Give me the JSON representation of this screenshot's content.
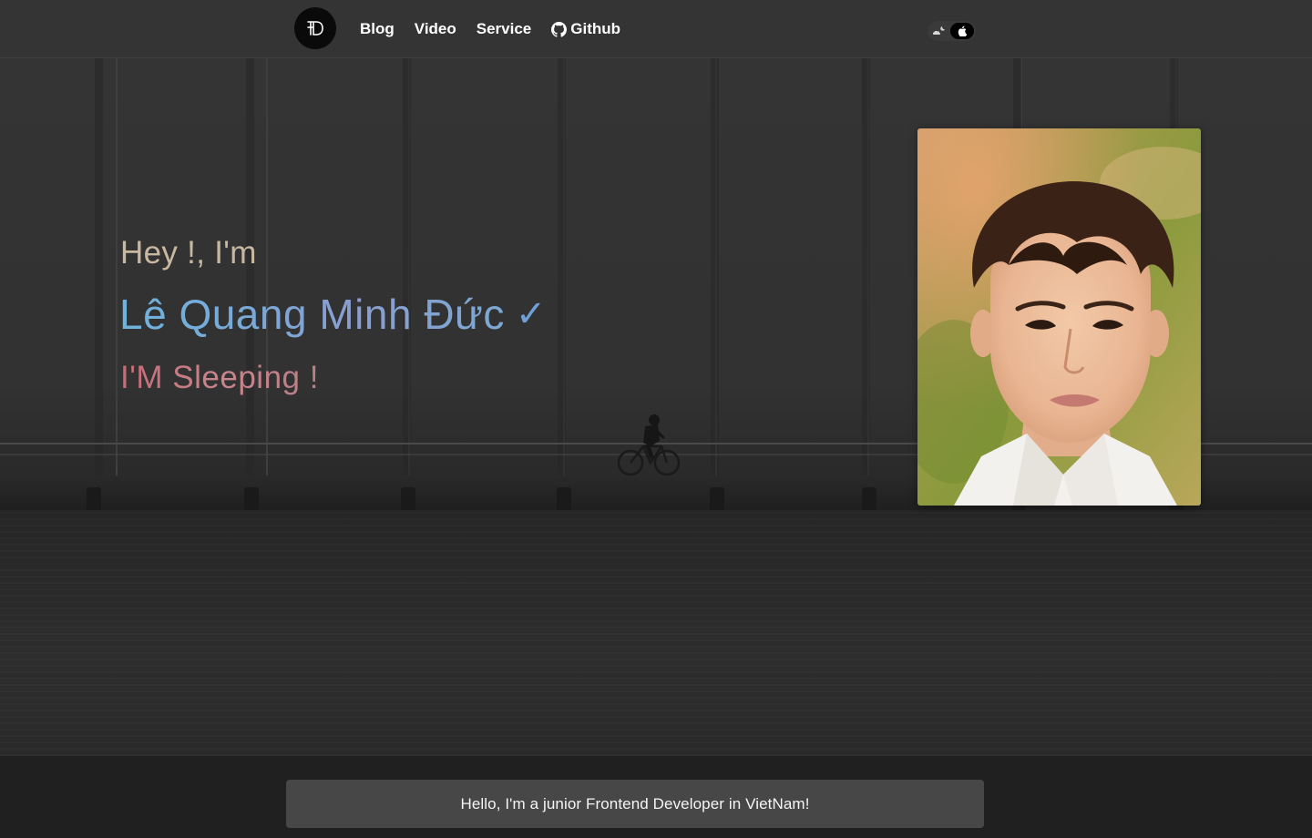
{
  "nav": {
    "logo_icon": "df-monogram-logo",
    "links": [
      {
        "label": "Blog"
      },
      {
        "label": "Video"
      },
      {
        "label": "Service"
      },
      {
        "label": "Github",
        "icon": "github-icon"
      }
    ],
    "theme_toggle": {
      "left_icon": "moon-cloud-icon",
      "right_icon": "apple-icon"
    }
  },
  "hero": {
    "greeting": "Hey !, I'm",
    "name": "Lê Quang Minh Đức",
    "check_mark": "✓",
    "status": "I'M Sleeping !"
  },
  "footer": {
    "intro": "Hello, I'm a junior Frontend Developer in VietNam!"
  },
  "colors": {
    "background": "#222222",
    "greeting": "#c9b8a0",
    "name_gradient_start": "#6fb3dd",
    "name_gradient_end": "#8a9ed0",
    "status": "#c76a78",
    "intro_box": "#474747"
  }
}
